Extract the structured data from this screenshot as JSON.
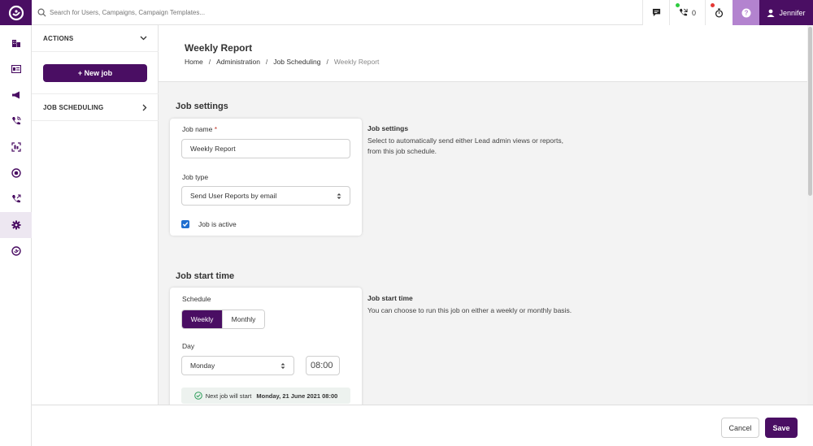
{
  "colors": {
    "brand": "#4a0e63",
    "help_bg": "#b383cf",
    "checkbox": "#1f6fd0",
    "green_dot": "#2ecc40",
    "red_dot": "#e53935"
  },
  "topbar": {
    "search_placeholder": "Search for Users, Campaigns, Campaign Templates...",
    "call_count": "0",
    "user_name": "Jennifer",
    "icons": [
      "logo-icon",
      "search-icon",
      "chat-icon",
      "phone-icon",
      "stopwatch-icon",
      "help-icon",
      "user-icon"
    ]
  },
  "rail": {
    "items": [
      "building-icon",
      "id-card-icon",
      "megaphone-icon",
      "phone-call-icon",
      "grid-scan-icon",
      "target-icon",
      "phone-transfer-icon",
      "gear-icon",
      "brand-icon"
    ],
    "active_item": "gear-icon"
  },
  "actions_panel": {
    "actions_label": "ACTIONS",
    "new_job_label": "+ New job",
    "job_scheduling_label": "JOB SCHEDULING"
  },
  "header": {
    "title": "Weekly Report",
    "breadcrumb": [
      "Home",
      "Administration",
      "Job Scheduling",
      "Weekly Report"
    ]
  },
  "job_settings": {
    "section_title": "Job settings",
    "job_name_label": "Job name",
    "required_mark": "*",
    "job_name_value": "Weekly Report",
    "job_type_label": "Job type",
    "job_type_value": "Send User Reports by email",
    "job_active_label": "Job is active",
    "job_active_checked": true,
    "help_title": "Job settings",
    "help_text": "Select to automatically send either Lead admin views or reports, from this job schedule."
  },
  "job_start_time": {
    "section_title": "Job start time",
    "schedule_label": "Schedule",
    "schedule_options": [
      "Weekly",
      "Monthly"
    ],
    "schedule_selected": "Weekly",
    "day_label": "Day",
    "day_value": "Monday",
    "time_value": "08:00",
    "next_job_label": "Next job will start",
    "next_job_value": "Monday, 21 June 2021 08:00",
    "help_title": "Job start time",
    "help_text": "You can choose to run this job on either a weekly or monthly basis."
  },
  "footer": {
    "cancel_label": "Cancel",
    "save_label": "Save"
  }
}
